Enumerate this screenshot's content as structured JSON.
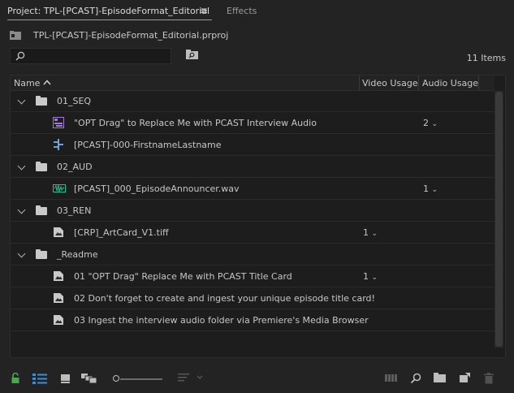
{
  "tabs": {
    "project_title": "Project: TPL-[PCAST]-EpisodeFormat_Editorial",
    "menu_glyph": "≡",
    "effects": "Effects"
  },
  "project_file": "TPL-[PCAST]-EpisodeFormat_Editorial.prproj",
  "search": {
    "value": "",
    "placeholder": ""
  },
  "item_count": "11 Items",
  "columns": {
    "name": "Name",
    "video_usage": "Video Usage",
    "audio_usage": "Audio Usage"
  },
  "rows": [
    {
      "kind": "bin",
      "name": "01_SEQ",
      "video_usage": "",
      "audio_usage": ""
    },
    {
      "kind": "sequence",
      "name": "\"OPT Drag\" to Replace Me with PCAST Interview Audio",
      "video_usage": "",
      "audio_usage": "2"
    },
    {
      "kind": "multicam",
      "name": "[PCAST]-000-FirstnameLastname",
      "video_usage": "",
      "audio_usage": ""
    },
    {
      "kind": "bin",
      "name": "02_AUD",
      "video_usage": "",
      "audio_usage": ""
    },
    {
      "kind": "audio",
      "name": "[PCAST]_000_EpisodeAnnouncer.wav",
      "video_usage": "",
      "audio_usage": "1"
    },
    {
      "kind": "bin",
      "name": "03_REN",
      "video_usage": "",
      "audio_usage": ""
    },
    {
      "kind": "still",
      "name": "[CRP]_ArtCard_V1.tiff",
      "video_usage": "1",
      "audio_usage": ""
    },
    {
      "kind": "bin",
      "name": "_Readme",
      "video_usage": "",
      "audio_usage": ""
    },
    {
      "kind": "still",
      "name": "01 \"OPT Drag\" Replace Me with PCAST Title Card",
      "video_usage": "1",
      "audio_usage": ""
    },
    {
      "kind": "still",
      "name": "02 Don't forget to create and ingest your unique episode title card!",
      "video_usage": "",
      "audio_usage": ""
    },
    {
      "kind": "still",
      "name": "03 Ingest the interview audio folder via Premiere's Media Browser",
      "video_usage": "",
      "audio_usage": ""
    }
  ],
  "colors": {
    "lock": "#3fae49",
    "list_view_active": "#3a8fd9",
    "sequence_icon": "#9f7bd8",
    "audio_icon": "#25c28f",
    "multicam_icon": "#6fa0d6"
  }
}
